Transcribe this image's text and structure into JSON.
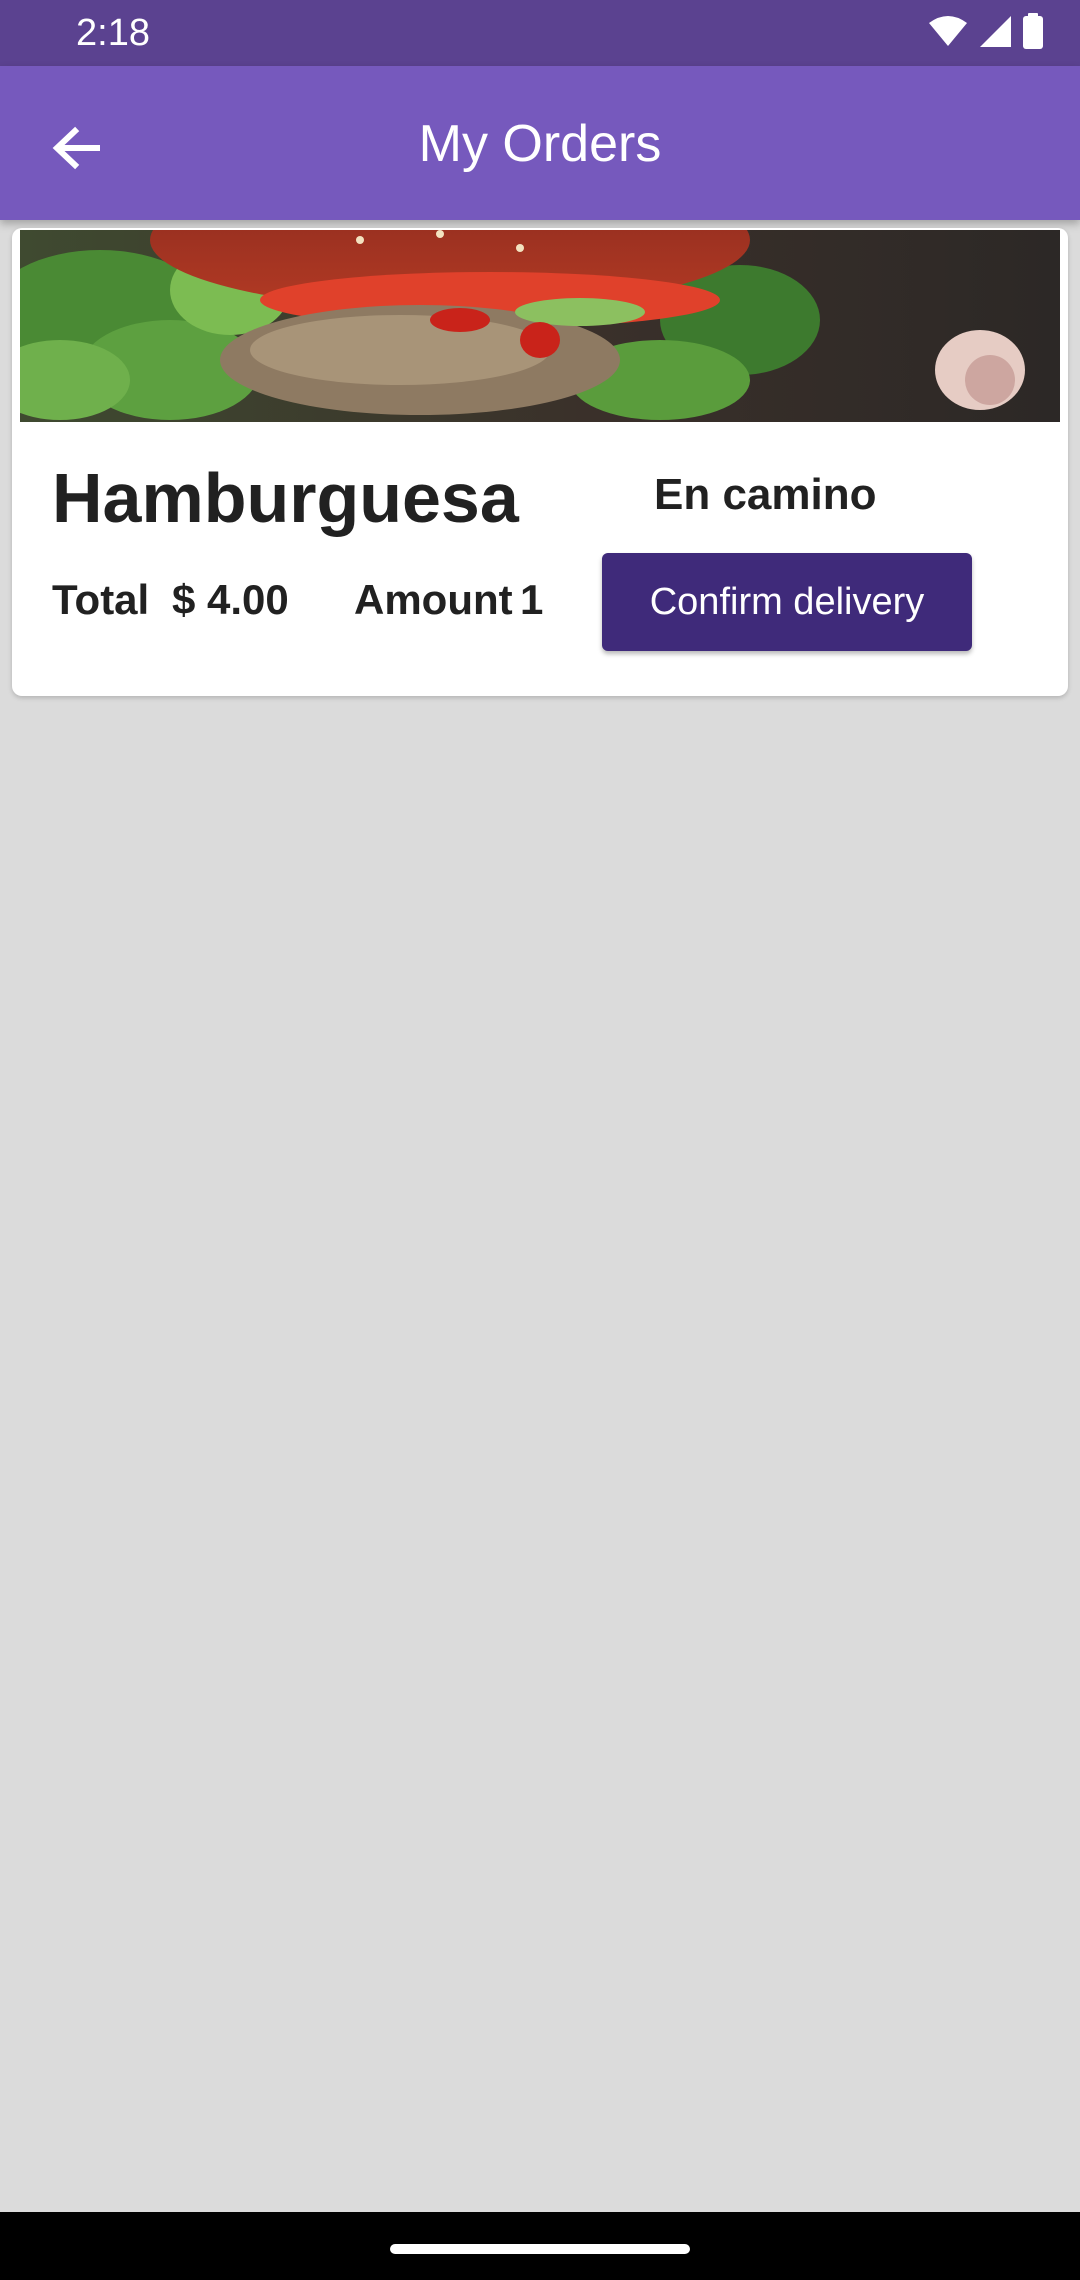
{
  "status_bar": {
    "time": "2:18",
    "icons": [
      "wifi-icon",
      "cell-signal-icon",
      "battery-icon"
    ]
  },
  "app_bar": {
    "title": "My Orders",
    "back_icon": "arrow-left-icon",
    "background": "#7659bd"
  },
  "orders": [
    {
      "image": "burger-photo",
      "name": "Hamburguesa",
      "status": "En camino",
      "total_label": "Total",
      "total_value": "$ 4.00",
      "amount_label": "Amount",
      "amount_value": "1",
      "confirm_label": "Confirm delivery"
    }
  ],
  "colors": {
    "status_bar": "#5b4290",
    "app_bar": "#7659bd",
    "button": "#3f2a7a",
    "background": "#dbdbdb"
  }
}
